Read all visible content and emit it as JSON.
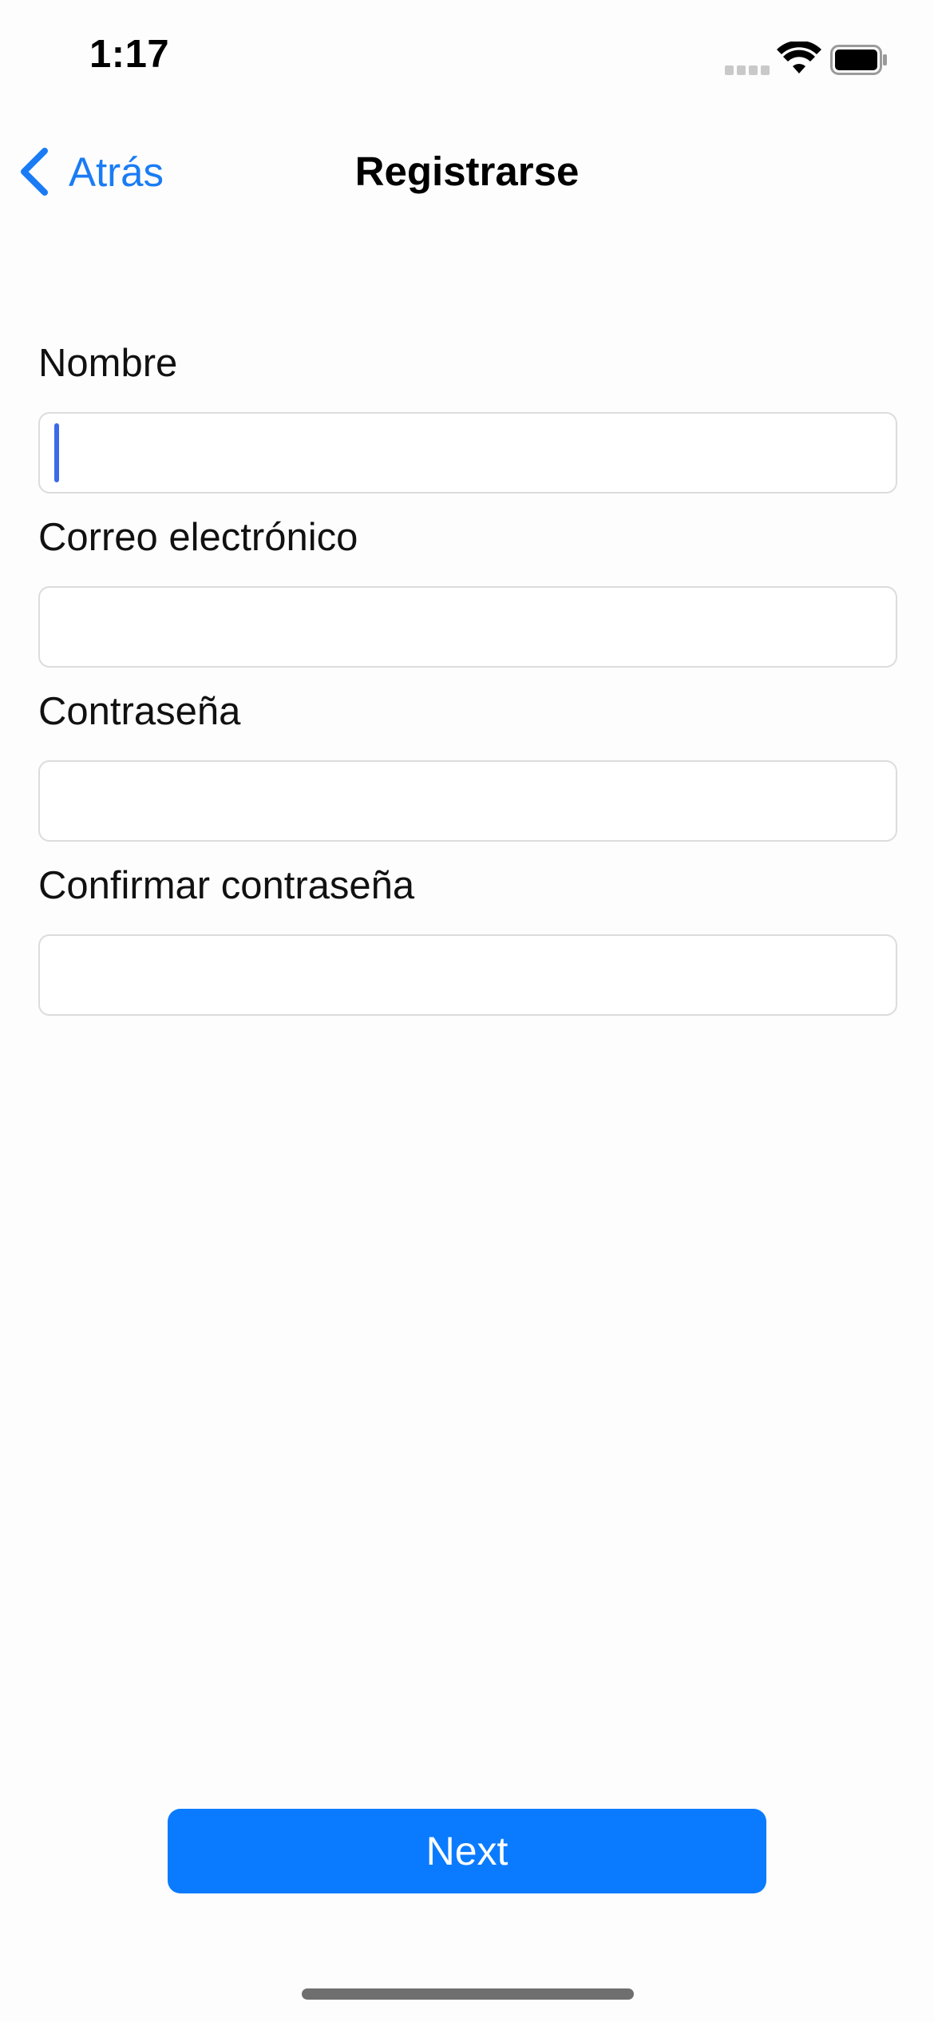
{
  "status_bar": {
    "time": "1:17",
    "icons": [
      "cellular-signal-icon",
      "wifi-icon",
      "battery-icon"
    ]
  },
  "nav": {
    "back_label": "Atrás",
    "back_icon": "chevron-left-icon",
    "title": "Registrarse"
  },
  "form": {
    "fields": [
      {
        "label": "Nombre",
        "value": "",
        "placeholder": "",
        "focused": true
      },
      {
        "label": "Correo electrónico",
        "value": "",
        "placeholder": ""
      },
      {
        "label": "Contraseña",
        "value": "",
        "placeholder": ""
      },
      {
        "label": "Confirmar contraseña",
        "value": "",
        "placeholder": ""
      }
    ]
  },
  "actions": {
    "next_label": "Next"
  },
  "colors": {
    "accent": "#1a7cf5",
    "button": "#0a7bff",
    "cursor": "#3b6ae8"
  }
}
